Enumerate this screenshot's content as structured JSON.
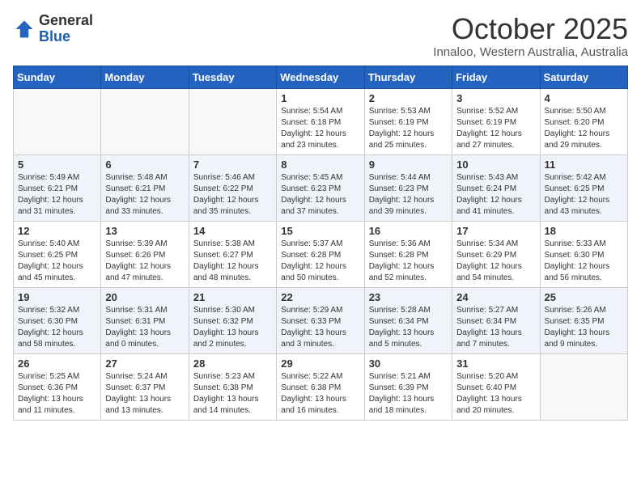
{
  "header": {
    "logo_line1": "General",
    "logo_line2": "Blue",
    "title": "October 2025",
    "subtitle": "Innaloo, Western Australia, Australia"
  },
  "weekdays": [
    "Sunday",
    "Monday",
    "Tuesday",
    "Wednesday",
    "Thursday",
    "Friday",
    "Saturday"
  ],
  "weeks": [
    [
      {
        "day": "",
        "info": ""
      },
      {
        "day": "",
        "info": ""
      },
      {
        "day": "",
        "info": ""
      },
      {
        "day": "1",
        "info": "Sunrise: 5:54 AM\nSunset: 6:18 PM\nDaylight: 12 hours\nand 23 minutes."
      },
      {
        "day": "2",
        "info": "Sunrise: 5:53 AM\nSunset: 6:19 PM\nDaylight: 12 hours\nand 25 minutes."
      },
      {
        "day": "3",
        "info": "Sunrise: 5:52 AM\nSunset: 6:19 PM\nDaylight: 12 hours\nand 27 minutes."
      },
      {
        "day": "4",
        "info": "Sunrise: 5:50 AM\nSunset: 6:20 PM\nDaylight: 12 hours\nand 29 minutes."
      }
    ],
    [
      {
        "day": "5",
        "info": "Sunrise: 5:49 AM\nSunset: 6:21 PM\nDaylight: 12 hours\nand 31 minutes."
      },
      {
        "day": "6",
        "info": "Sunrise: 5:48 AM\nSunset: 6:21 PM\nDaylight: 12 hours\nand 33 minutes."
      },
      {
        "day": "7",
        "info": "Sunrise: 5:46 AM\nSunset: 6:22 PM\nDaylight: 12 hours\nand 35 minutes."
      },
      {
        "day": "8",
        "info": "Sunrise: 5:45 AM\nSunset: 6:23 PM\nDaylight: 12 hours\nand 37 minutes."
      },
      {
        "day": "9",
        "info": "Sunrise: 5:44 AM\nSunset: 6:23 PM\nDaylight: 12 hours\nand 39 minutes."
      },
      {
        "day": "10",
        "info": "Sunrise: 5:43 AM\nSunset: 6:24 PM\nDaylight: 12 hours\nand 41 minutes."
      },
      {
        "day": "11",
        "info": "Sunrise: 5:42 AM\nSunset: 6:25 PM\nDaylight: 12 hours\nand 43 minutes."
      }
    ],
    [
      {
        "day": "12",
        "info": "Sunrise: 5:40 AM\nSunset: 6:25 PM\nDaylight: 12 hours\nand 45 minutes."
      },
      {
        "day": "13",
        "info": "Sunrise: 5:39 AM\nSunset: 6:26 PM\nDaylight: 12 hours\nand 47 minutes."
      },
      {
        "day": "14",
        "info": "Sunrise: 5:38 AM\nSunset: 6:27 PM\nDaylight: 12 hours\nand 48 minutes."
      },
      {
        "day": "15",
        "info": "Sunrise: 5:37 AM\nSunset: 6:28 PM\nDaylight: 12 hours\nand 50 minutes."
      },
      {
        "day": "16",
        "info": "Sunrise: 5:36 AM\nSunset: 6:28 PM\nDaylight: 12 hours\nand 52 minutes."
      },
      {
        "day": "17",
        "info": "Sunrise: 5:34 AM\nSunset: 6:29 PM\nDaylight: 12 hours\nand 54 minutes."
      },
      {
        "day": "18",
        "info": "Sunrise: 5:33 AM\nSunset: 6:30 PM\nDaylight: 12 hours\nand 56 minutes."
      }
    ],
    [
      {
        "day": "19",
        "info": "Sunrise: 5:32 AM\nSunset: 6:30 PM\nDaylight: 12 hours\nand 58 minutes."
      },
      {
        "day": "20",
        "info": "Sunrise: 5:31 AM\nSunset: 6:31 PM\nDaylight: 13 hours\nand 0 minutes."
      },
      {
        "day": "21",
        "info": "Sunrise: 5:30 AM\nSunset: 6:32 PM\nDaylight: 13 hours\nand 2 minutes."
      },
      {
        "day": "22",
        "info": "Sunrise: 5:29 AM\nSunset: 6:33 PM\nDaylight: 13 hours\nand 3 minutes."
      },
      {
        "day": "23",
        "info": "Sunrise: 5:28 AM\nSunset: 6:34 PM\nDaylight: 13 hours\nand 5 minutes."
      },
      {
        "day": "24",
        "info": "Sunrise: 5:27 AM\nSunset: 6:34 PM\nDaylight: 13 hours\nand 7 minutes."
      },
      {
        "day": "25",
        "info": "Sunrise: 5:26 AM\nSunset: 6:35 PM\nDaylight: 13 hours\nand 9 minutes."
      }
    ],
    [
      {
        "day": "26",
        "info": "Sunrise: 5:25 AM\nSunset: 6:36 PM\nDaylight: 13 hours\nand 11 minutes."
      },
      {
        "day": "27",
        "info": "Sunrise: 5:24 AM\nSunset: 6:37 PM\nDaylight: 13 hours\nand 13 minutes."
      },
      {
        "day": "28",
        "info": "Sunrise: 5:23 AM\nSunset: 6:38 PM\nDaylight: 13 hours\nand 14 minutes."
      },
      {
        "day": "29",
        "info": "Sunrise: 5:22 AM\nSunset: 6:38 PM\nDaylight: 13 hours\nand 16 minutes."
      },
      {
        "day": "30",
        "info": "Sunrise: 5:21 AM\nSunset: 6:39 PM\nDaylight: 13 hours\nand 18 minutes."
      },
      {
        "day": "31",
        "info": "Sunrise: 5:20 AM\nSunset: 6:40 PM\nDaylight: 13 hours\nand 20 minutes."
      },
      {
        "day": "",
        "info": ""
      }
    ]
  ]
}
